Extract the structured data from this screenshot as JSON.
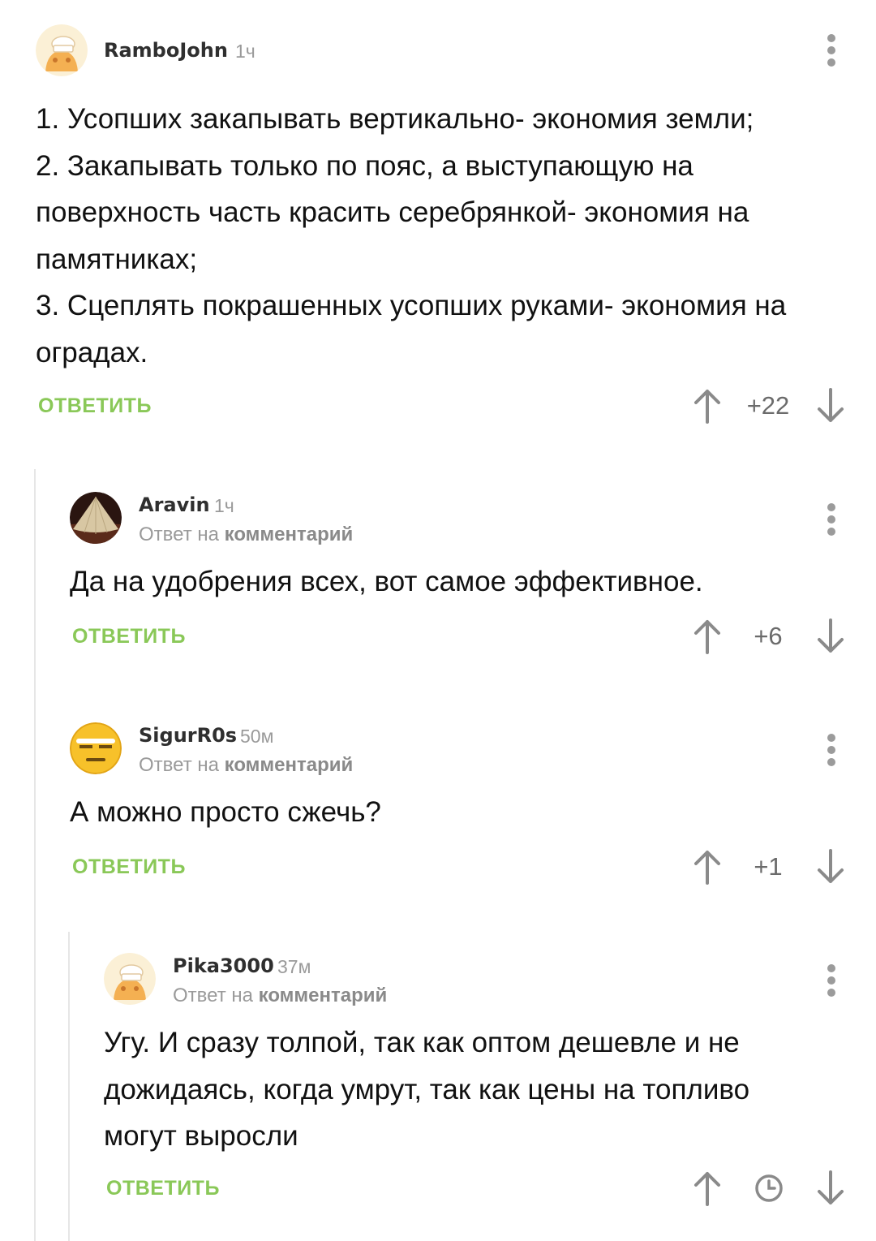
{
  "comments": [
    {
      "username": "RamboJohn",
      "time": "1ч",
      "lines": [
        "1. Усопших закапывать вертикально- экономия земли;",
        "2. Закапывать только по пояс, а выступающую на",
        "поверхность часть красить серебрянкой- экономия на",
        "памятниках;",
        "3. Сцеплять покрашенных усопших руками- экономия на",
        "оградах."
      ],
      "reply_label": "ОТВЕТИТЬ",
      "rating": "+22"
    },
    {
      "username": "Aravin",
      "time": "1ч",
      "reply_to_prefix": "Ответ на",
      "reply_to_link": "комментарий",
      "lines": [
        "Да на удобрения всех, вот самое эффективное."
      ],
      "reply_label": "ОТВЕТИТЬ",
      "rating": "+6"
    },
    {
      "username": "SigurR0s",
      "time": "50м",
      "reply_to_prefix": "Ответ на",
      "reply_to_link": "комментарий",
      "lines": [
        "А можно просто сжечь?"
      ],
      "reply_label": "ОТВЕТИТЬ",
      "rating": "+1"
    },
    {
      "username": "Pika3000",
      "time": "37м",
      "reply_to_prefix": "Ответ на",
      "reply_to_link": "комментарий",
      "lines": [
        "Угу. И сразу толпой, так как оптом дешевле и не",
        "дожидаясь, когда умрут, так как цены на топливо",
        "могут выросли"
      ],
      "reply_label": "ОТВЕТИТЬ",
      "rating_icon": "clock-icon"
    }
  ],
  "colors": {
    "accent_green": "#8ac858",
    "muted_gray": "#9a9a9a",
    "thread_line": "#e6e6e6"
  },
  "icons": [
    "menu-dots-icon",
    "upvote-arrow-icon",
    "downvote-arrow-icon",
    "clock-icon"
  ]
}
